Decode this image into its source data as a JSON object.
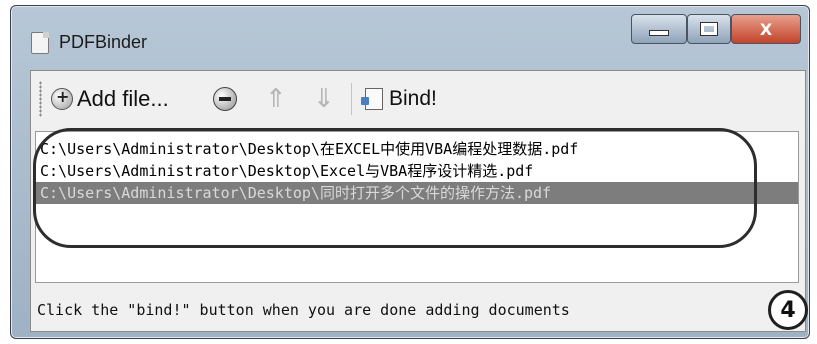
{
  "window": {
    "title": "PDFBinder",
    "close_label": "X"
  },
  "toolbar": {
    "add_label": "Add file...",
    "up_glyph": "⇑",
    "down_glyph": "⇓",
    "bind_label": "Bind!"
  },
  "files": [
    "C:\\Users\\Administrator\\Desktop\\在EXCEL中使用VBA编程处理数据.pdf",
    "C:\\Users\\Administrator\\Desktop\\Excel与VBA程序设计精选.pdf",
    "C:\\Users\\Administrator\\Desktop\\同时打开多个文件的操作方法.pdf"
  ],
  "status": "Click the \"bind!\" button when you are done adding documents",
  "step_number": "4"
}
